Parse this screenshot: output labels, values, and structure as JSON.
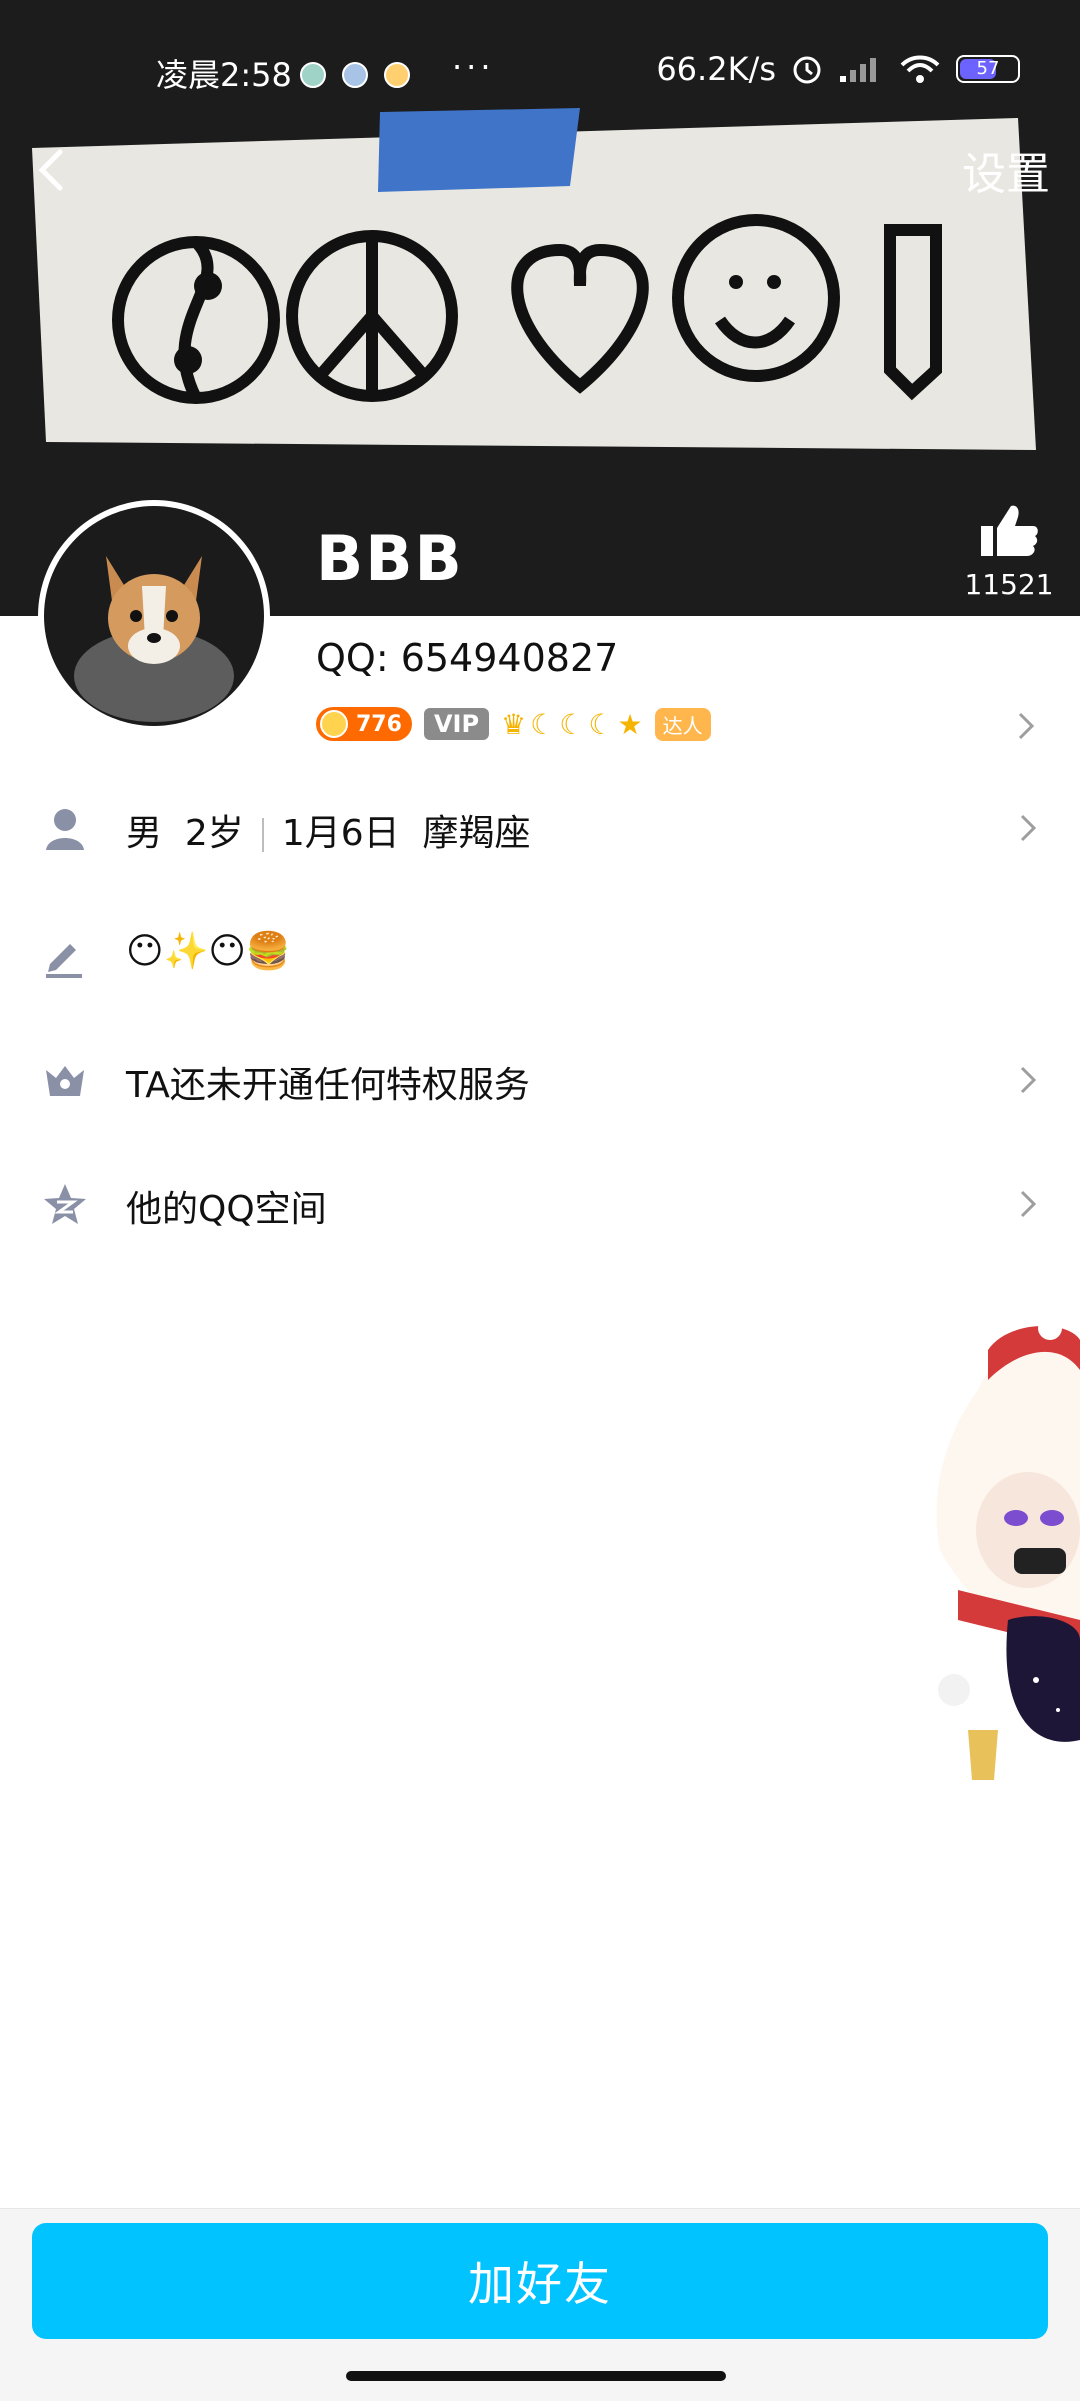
{
  "status_bar": {
    "time": "凌晨2:58",
    "more": "···",
    "speed": "66.2K/s",
    "battery": "57"
  },
  "header": {
    "settings_label": "设置",
    "nickname": "BBB",
    "like_count": "11521"
  },
  "profile": {
    "qq_label": "QQ: 654940827",
    "coin_value": "776",
    "vip_label": "VIP",
    "talent_label": "达人"
  },
  "rows": {
    "basic": {
      "gender": "男",
      "age": "2岁",
      "birthday": "1月6日",
      "zodiac": "摩羯座"
    },
    "signature": "😶✨😶🍔",
    "privilege": "TA还未开通任何特权服务",
    "qzone": "他的QQ空间"
  },
  "actions": {
    "add_friend": "加好友"
  }
}
